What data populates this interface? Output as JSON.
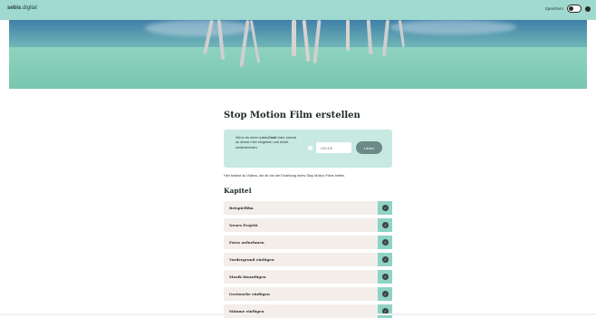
{
  "header": {
    "brand_bold": "sebis",
    "brand_thin": ".digital",
    "save_label": "Speichern"
  },
  "hero": {
    "icon": "photo-banner"
  },
  "main": {
    "title": "Stop Motion Film erstellen",
    "code_box": {
      "text_before": "Wenn du einen ",
      "text_bold": "Lern-Code",
      "text_after": " hast, kannst du diesen hier eingeben und direkt weiterarbeiten",
      "input_placeholder": "LBCDE",
      "button_label": "Laden"
    },
    "intro": "Hier findest du Videos, die dir bei der Erstellung eines Stop Motion Films helfen.",
    "chapter_heading": "Kapitel",
    "chapters": [
      {
        "label": "Beispielfilm"
      },
      {
        "label": "Neues Projekt"
      },
      {
        "label": "Fotos aufnehmen"
      },
      {
        "label": "Vordergrund einfügen"
      },
      {
        "label": "Musik hinzufügen"
      },
      {
        "label": "Geräusche einfügen"
      },
      {
        "label": "Stimme einfügen"
      }
    ]
  },
  "colors": {
    "accent": "#9fd9cf",
    "chapter_bg": "#f3eeea",
    "check_bg": "#8fd3c4"
  }
}
